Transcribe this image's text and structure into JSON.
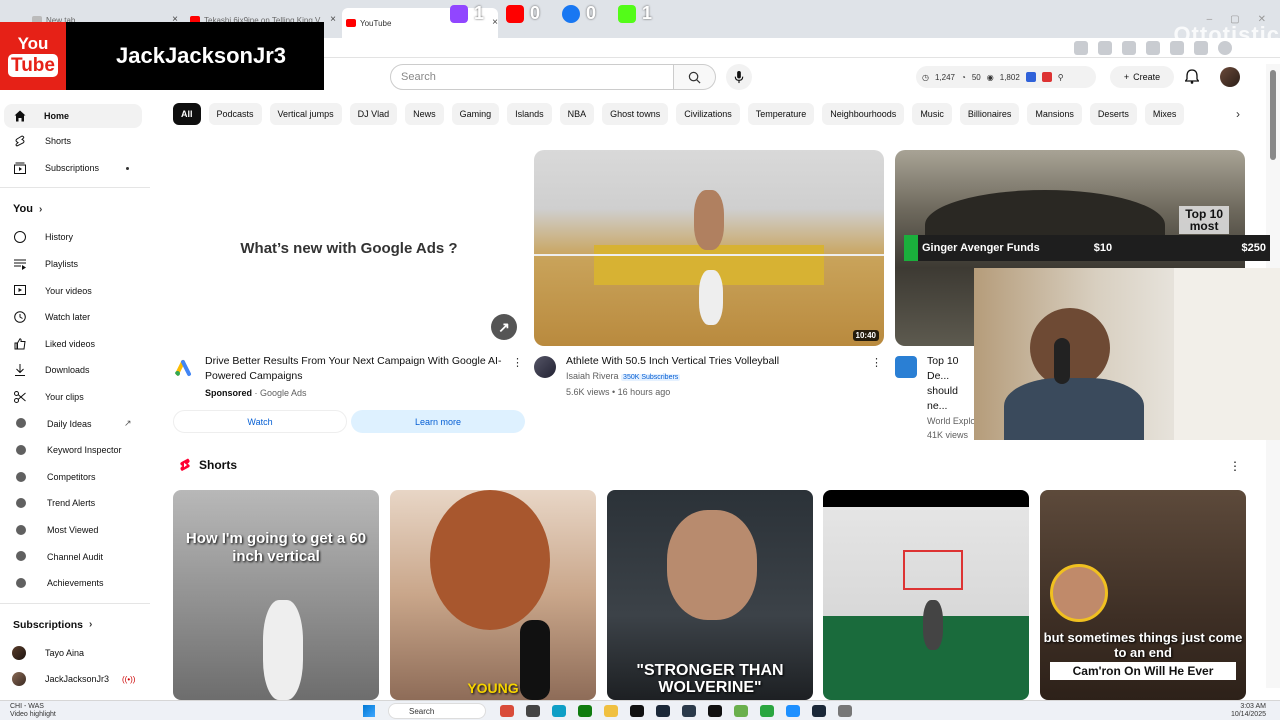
{
  "browser": {
    "tabs": [
      {
        "label": "New tab",
        "close": "×"
      },
      {
        "label": "Tekashi 6ix9ine on Telling King V",
        "close": "×"
      },
      {
        "label": "YouTube",
        "close": "×"
      }
    ],
    "new_tab": "+",
    "window_controls": [
      "–",
      "▢",
      "✕"
    ]
  },
  "stream": {
    "counters": [
      {
        "platform": "twitch",
        "value": "1",
        "color": "#9146ff"
      },
      {
        "platform": "youtube",
        "value": "0",
        "color": "#ff0000"
      },
      {
        "platform": "facebook",
        "value": "0",
        "color": "#1877f2"
      },
      {
        "platform": "kick",
        "value": "1",
        "color": "#53fc18"
      }
    ],
    "watermark": "Ottotistic",
    "channel_overlay": {
      "logo_line1": "You",
      "logo_line2": "Tube",
      "name": "JackJacksonJr3"
    },
    "donation": {
      "name": "Ginger Avenger Funds",
      "amount": "$10",
      "goal": "$250"
    },
    "thumb_overlay": {
      "line1": "Top 10",
      "line2": "most"
    }
  },
  "topbar": {
    "search_placeholder": "Search",
    "stats": {
      "views": "1,247",
      "likes": "50",
      "watch": "1,802"
    },
    "create_label": "Create"
  },
  "sidebar": {
    "main": [
      {
        "label": "Home",
        "icon": "home-icon"
      },
      {
        "label": "Shorts",
        "icon": "shorts-icon"
      },
      {
        "label": "Subscriptions",
        "icon": "subscriptions-icon"
      }
    ],
    "you_label": "You",
    "you_items": [
      {
        "label": "History",
        "icon": "history-icon"
      },
      {
        "label": "Playlists",
        "icon": "playlists-icon"
      },
      {
        "label": "Your videos",
        "icon": "your-videos-icon"
      },
      {
        "label": "Watch later",
        "icon": "watch-later-icon"
      },
      {
        "label": "Liked videos",
        "icon": "thumbs-up-icon"
      },
      {
        "label": "Downloads",
        "icon": "download-icon"
      },
      {
        "label": "Your clips",
        "icon": "scissors-icon"
      },
      {
        "label": "Daily Ideas",
        "icon": "vidiq-icon"
      },
      {
        "label": "Keyword Inspector",
        "icon": "vidiq-icon"
      },
      {
        "label": "Competitors",
        "icon": "vidiq-icon"
      },
      {
        "label": "Trend Alerts",
        "icon": "vidiq-icon"
      },
      {
        "label": "Most Viewed",
        "icon": "vidiq-icon"
      },
      {
        "label": "Channel Audit",
        "icon": "vidiq-icon"
      },
      {
        "label": "Achievements",
        "icon": "vidiq-icon"
      }
    ],
    "subscriptions_label": "Subscriptions",
    "subscriptions": [
      {
        "label": "Tayo Aina"
      },
      {
        "label": "JackJacksonJr3"
      }
    ]
  },
  "chips": [
    "All",
    "Podcasts",
    "Vertical jumps",
    "DJ Vlad",
    "News",
    "Gaming",
    "Islands",
    "NBA",
    "Ghost towns",
    "Civilizations",
    "Temperature",
    "Neighbourhoods",
    "Music",
    "Billionaires",
    "Mansions",
    "Deserts",
    "Mixes"
  ],
  "ad": {
    "thumb_text": "What’s new with Google Ads ?",
    "title": "Drive Better Results From Your Next Campaign With Google AI-Powered Campaigns",
    "sponsored": "Sponsored",
    "advertiser": "Google Ads",
    "watch": "Watch",
    "learn_more": "Learn more"
  },
  "videos": [
    {
      "title": "Athlete With 50.5 Inch Vertical Tries Volleyball",
      "channel": "Isaiah Rivera",
      "subs": "350K Subscribers",
      "meta": "5.6K views • 16 hours ago",
      "duration": "10:40"
    },
    {
      "title": "Top 10 De... should ne...",
      "channel": "World Explo...",
      "meta": "41K views"
    }
  ],
  "shorts": {
    "heading": "Shorts",
    "items": [
      {
        "caption": "How I'm going to get a 60 inch vertical"
      },
      {
        "caption": "YOUNG"
      },
      {
        "caption": "\"STRONGER THAN WOLVERINE\""
      },
      {
        "caption": ""
      },
      {
        "caption": "but sometimes things just come to an end",
        "sub": "Cam'ron On Will He Ever"
      }
    ]
  },
  "taskbar": {
    "weather_line1": "CHI - WAS",
    "weather_line2": "Video highlight",
    "search": "Search",
    "time": "3:03 AM",
    "date": "10/14/2025"
  }
}
